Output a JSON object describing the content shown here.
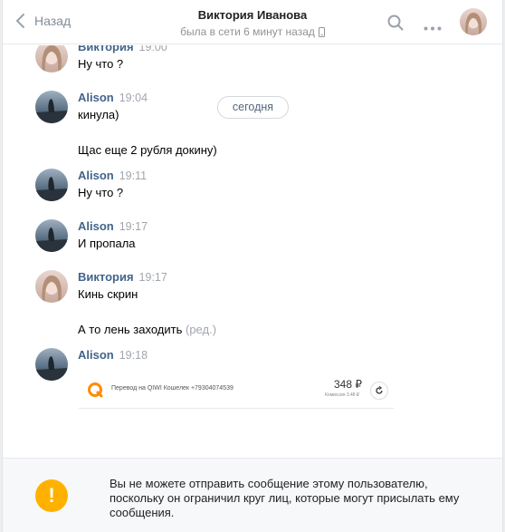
{
  "header": {
    "back_label": "Назад",
    "title": "Виктория Иванова",
    "status": "была в сети 6 минут назад"
  },
  "date_divider": "сегодня",
  "messages": [
    {
      "author": "Виктория",
      "time": "19:00",
      "text": "Ну что ?"
    },
    {
      "author": "Alison",
      "time": "19:04",
      "text": "кинула)",
      "text2": "Щас еще 2 рубля докину)"
    },
    {
      "author": "Alison",
      "time": "19:11",
      "text": "Ну что ?"
    },
    {
      "author": "Alison",
      "time": "19:17",
      "text": "И пропала"
    },
    {
      "author": "Виктория",
      "time": "19:17",
      "text": "Кинь скрин",
      "text2": "А то лень заходить",
      "edited": " (ред.)"
    },
    {
      "author": "Alison",
      "time": "19:18"
    }
  ],
  "transfer": {
    "description": "Перевод на QIWI Кошелек +79304074539",
    "amount": "348 ₽",
    "fee": "Комиссия 3.48 ₽"
  },
  "notice": "Вы не можете отправить сообщение этому пользователю, поскольку он ограничил круг лиц, которые могут присылать ему сообщения.",
  "colors": {
    "accent": "#42648b",
    "warning": "#ffb100",
    "muted": "#a1a6ad"
  },
  "icons": {
    "back": "chevron-left-icon",
    "search": "search-icon",
    "more": "more-horizontal-icon",
    "mobile": "mobile-phone-icon",
    "warning": "exclamation-icon",
    "qiwi": "qiwi-logo-icon"
  }
}
